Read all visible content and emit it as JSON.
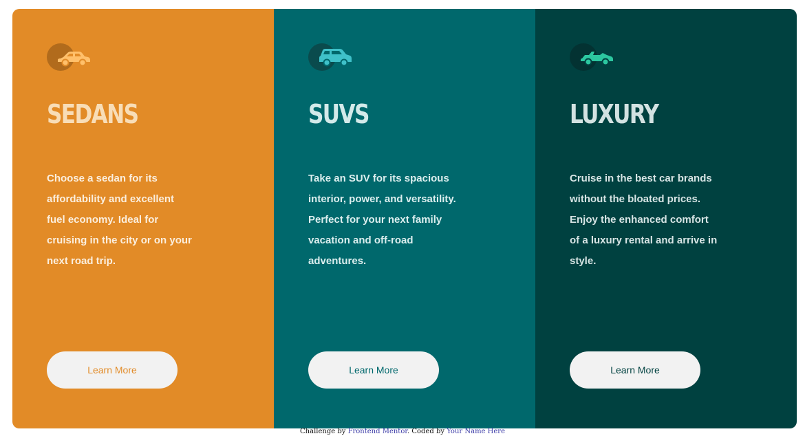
{
  "colors": {
    "sedans": "#e28b27",
    "suvs": "#00686c",
    "luxury": "#004140",
    "button_bg": "#f2f2f2"
  },
  "cards": [
    {
      "icon": "sedan-car-icon",
      "title": "SEDANS",
      "text": "Choose a sedan for its affordability and excellent fuel economy. Ideal for cruising in the city or on your next road trip.",
      "button_label": "Learn More"
    },
    {
      "icon": "suv-car-icon",
      "title": "SUVS",
      "text": "Take an SUV for its spacious interior, power, and versatility. Perfect for your next family vacation and off-road adventures.",
      "button_label": "Learn More"
    },
    {
      "icon": "luxury-car-icon",
      "title": "LUXURY",
      "text": "Cruise in the best car brands without the bloated prices. Enjoy the enhanced comfort of a luxury rental and arrive in style.",
      "button_label": "Learn More"
    }
  ],
  "attribution": {
    "prefix": "Challenge by ",
    "link1": "Frontend Mentor",
    "middle": ". Coded by ",
    "link2": "Your Name Here"
  }
}
